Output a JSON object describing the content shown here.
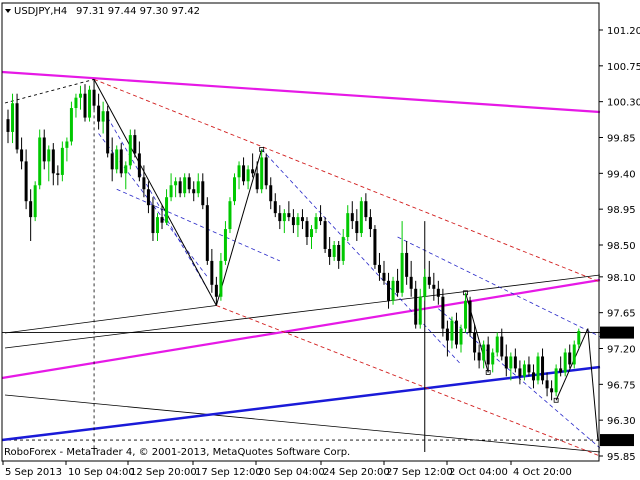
{
  "header": {
    "symbol": "USDJPY,H4",
    "ohlc": "97.31 97.44 97.30 97.42"
  },
  "footer": {
    "copyright": "RoboForex - MetaTrader 4, © 2001-2013, MetaQuotes Software Corp."
  },
  "colors": {
    "bull": "#00c800",
    "bear": "#000000",
    "magenta": "#e619e6",
    "blue": "#1a1ad8",
    "red_dash": "#d21e1e",
    "blue_dash": "#2828c8",
    "thin": "#000000",
    "badge_bg": "#000000",
    "badge_text": "#ffffff"
  },
  "chart_data": {
    "type": "candlestick",
    "title": "USDJPY,H4",
    "ylim": [
      95.7,
      101.5
    ],
    "y_ticks": [
      "101.20",
      "100.75",
      "100.30",
      "99.85",
      "99.40",
      "98.95",
      "98.50",
      "98.10",
      "97.65",
      "97.20",
      "96.75",
      "96.30",
      "95.85"
    ],
    "badges": [
      {
        "label": "97.40",
        "value": 97.4
      },
      {
        "label": "96.05",
        "value": 96.05
      }
    ],
    "x_ticks": [
      "5 Sep 2013",
      "10 Sep 04:00",
      "12 Sep 20:00",
      "17 Sep 12:00",
      "20 Sep 04:00",
      "24 Sep 20:00",
      "27 Sep 12:00",
      "2 Oct 04:00",
      "4 Oct 20:00"
    ],
    "anchors": [
      {
        "bar": 19,
        "high": 100.58
      },
      {
        "bar": 46,
        "low": 97.74
      },
      {
        "bar": 56,
        "high": 99.7
      },
      {
        "bar": 87,
        "high": 98.8
      },
      {
        "bar": 101,
        "high": 97.9
      },
      {
        "bar": 106,
        "low": 96.9
      },
      {
        "bar": 121,
        "low": 96.55
      },
      {
        "bar": 128,
        "high": 97.45
      }
    ],
    "candles": [
      [
        100.08,
        100.2,
        99.78,
        99.92
      ],
      [
        99.92,
        100.4,
        99.78,
        100.28
      ],
      [
        100.28,
        100.4,
        99.65,
        99.7
      ],
      [
        99.7,
        99.85,
        99.45,
        99.55
      ],
      [
        99.55,
        99.7,
        98.95,
        99.05
      ],
      [
        99.05,
        99.2,
        98.55,
        98.85
      ],
      [
        98.85,
        99.3,
        98.8,
        99.25
      ],
      [
        99.25,
        99.95,
        99.2,
        99.85
      ],
      [
        99.85,
        99.95,
        99.45,
        99.55
      ],
      [
        99.55,
        99.75,
        99.3,
        99.7
      ],
      [
        99.7,
        99.78,
        99.25,
        99.4
      ],
      [
        99.4,
        99.5,
        99.25,
        99.38
      ],
      [
        99.38,
        99.8,
        99.3,
        99.72
      ],
      [
        99.72,
        99.85,
        99.55,
        99.8
      ],
      [
        99.8,
        100.3,
        99.75,
        100.22
      ],
      [
        100.22,
        100.4,
        100.1,
        100.35
      ],
      [
        100.35,
        100.5,
        100.2,
        100.4
      ],
      [
        100.4,
        100.52,
        100.05,
        100.1
      ],
      [
        100.1,
        100.5,
        100.05,
        100.45
      ],
      [
        100.45,
        100.58,
        100.2,
        100.25
      ],
      [
        100.25,
        100.4,
        99.95,
        100.05
      ],
      [
        100.05,
        100.3,
        99.9,
        100.18
      ],
      [
        100.18,
        100.25,
        99.6,
        99.65
      ],
      [
        99.65,
        99.85,
        99.3,
        99.45
      ],
      [
        99.45,
        99.75,
        99.4,
        99.7
      ],
      [
        99.7,
        99.78,
        99.35,
        99.4
      ],
      [
        99.4,
        99.55,
        99.2,
        99.5
      ],
      [
        99.5,
        99.95,
        99.45,
        99.88
      ],
      [
        99.88,
        99.95,
        99.6,
        99.65
      ],
      [
        99.65,
        99.8,
        99.3,
        99.35
      ],
      [
        99.35,
        99.5,
        99.1,
        99.2
      ],
      [
        99.2,
        99.3,
        98.9,
        99.0
      ],
      [
        99.0,
        99.1,
        98.55,
        98.65
      ],
      [
        98.65,
        98.9,
        98.55,
        98.85
      ],
      [
        98.85,
        99.0,
        98.7,
        98.78
      ],
      [
        98.78,
        99.2,
        98.75,
        99.1
      ],
      [
        99.1,
        99.4,
        99.05,
        99.25
      ],
      [
        99.25,
        99.35,
        99.1,
        99.3
      ],
      [
        99.3,
        99.35,
        99.1,
        99.15
      ],
      [
        99.15,
        99.4,
        99.1,
        99.35
      ],
      [
        99.35,
        99.4,
        99.15,
        99.2
      ],
      [
        99.2,
        99.3,
        99.05,
        99.15
      ],
      [
        99.15,
        99.4,
        99.1,
        99.3
      ],
      [
        99.3,
        99.4,
        98.95,
        99.0
      ],
      [
        99.0,
        99.1,
        98.25,
        98.3
      ],
      [
        98.3,
        98.45,
        97.9,
        98.0
      ],
      [
        98.0,
        98.1,
        97.74,
        97.85
      ],
      [
        97.85,
        98.4,
        97.8,
        98.3
      ],
      [
        98.3,
        98.8,
        98.25,
        98.7
      ],
      [
        98.7,
        99.1,
        98.65,
        99.05
      ],
      [
        99.05,
        99.4,
        99.0,
        99.35
      ],
      [
        99.35,
        99.55,
        99.2,
        99.5
      ],
      [
        99.5,
        99.6,
        99.25,
        99.3
      ],
      [
        99.3,
        99.5,
        99.2,
        99.45
      ],
      [
        99.45,
        99.65,
        99.35,
        99.4
      ],
      [
        99.4,
        99.55,
        99.15,
        99.2
      ],
      [
        99.2,
        99.7,
        99.15,
        99.6
      ],
      [
        99.6,
        99.65,
        99.2,
        99.25
      ],
      [
        99.25,
        99.35,
        98.95,
        99.05
      ],
      [
        99.05,
        99.15,
        98.85,
        98.9
      ],
      [
        98.9,
        99.0,
        98.7,
        98.8
      ],
      [
        98.8,
        98.95,
        98.65,
        98.9
      ],
      [
        98.9,
        99.05,
        98.8,
        98.85
      ],
      [
        98.85,
        98.95,
        98.65,
        98.75
      ],
      [
        98.75,
        98.9,
        98.6,
        98.85
      ],
      [
        98.85,
        98.95,
        98.7,
        98.8
      ],
      [
        98.8,
        98.85,
        98.5,
        98.6
      ],
      [
        98.6,
        98.75,
        98.45,
        98.7
      ],
      [
        98.7,
        98.9,
        98.65,
        98.85
      ],
      [
        98.85,
        99.0,
        98.75,
        98.8
      ],
      [
        98.8,
        98.85,
        98.4,
        98.45
      ],
      [
        98.45,
        98.6,
        98.25,
        98.35
      ],
      [
        98.35,
        98.55,
        98.3,
        98.5
      ],
      [
        98.5,
        98.55,
        98.2,
        98.3
      ],
      [
        98.3,
        98.7,
        98.25,
        98.6
      ],
      [
        98.6,
        99.0,
        98.55,
        98.9
      ],
      [
        98.9,
        99.05,
        98.7,
        98.8
      ],
      [
        98.8,
        98.95,
        98.55,
        98.65
      ],
      [
        98.65,
        99.1,
        98.6,
        99.05
      ],
      [
        99.05,
        99.15,
        98.8,
        98.85
      ],
      [
        98.85,
        98.95,
        98.6,
        98.7
      ],
      [
        98.7,
        98.75,
        98.2,
        98.25
      ],
      [
        98.25,
        98.4,
        98.05,
        98.15
      ],
      [
        98.15,
        98.3,
        98.0,
        98.05
      ],
      [
        98.05,
        98.15,
        97.7,
        97.8
      ],
      [
        97.8,
        98.1,
        97.75,
        98.05
      ],
      [
        98.05,
        98.2,
        97.85,
        97.9
      ],
      [
        97.9,
        98.8,
        97.85,
        98.4
      ],
      [
        98.4,
        98.55,
        98.0,
        98.1
      ],
      [
        98.1,
        98.3,
        97.85,
        97.95
      ],
      [
        97.95,
        98.05,
        97.45,
        97.5
      ],
      [
        97.5,
        97.95,
        97.45,
        97.85
      ],
      [
        97.85,
        98.2,
        97.8,
        98.1
      ],
      [
        98.1,
        98.3,
        97.95,
        98.0
      ],
      [
        98.0,
        98.15,
        97.8,
        97.95
      ],
      [
        97.95,
        98.05,
        97.75,
        97.85
      ],
      [
        97.85,
        97.95,
        97.35,
        97.45
      ],
      [
        97.45,
        97.55,
        97.1,
        97.3
      ],
      [
        97.3,
        97.6,
        97.2,
        97.55
      ],
      [
        97.55,
        97.65,
        97.2,
        97.25
      ],
      [
        97.25,
        97.5,
        97.15,
        97.45
      ],
      [
        97.45,
        97.9,
        97.4,
        97.8
      ],
      [
        97.8,
        97.85,
        97.35,
        97.4
      ],
      [
        97.4,
        97.5,
        97.05,
        97.15
      ],
      [
        97.15,
        97.25,
        96.95,
        97.05
      ],
      [
        97.05,
        97.3,
        96.95,
        97.25
      ],
      [
        97.25,
        97.35,
        96.9,
        97.0
      ],
      [
        97.0,
        97.2,
        96.9,
        97.15
      ],
      [
        97.15,
        97.4,
        97.1,
        97.35
      ],
      [
        97.35,
        97.45,
        97.05,
        97.1
      ],
      [
        97.1,
        97.25,
        96.85,
        96.95
      ],
      [
        96.95,
        97.15,
        96.8,
        97.1
      ],
      [
        97.1,
        97.2,
        96.9,
        96.95
      ],
      [
        96.95,
        97.05,
        96.75,
        96.85
      ],
      [
        96.85,
        97.05,
        96.8,
        97.0
      ],
      [
        97.0,
        97.1,
        96.85,
        96.9
      ],
      [
        96.9,
        97.0,
        96.7,
        96.8
      ],
      [
        96.8,
        97.15,
        96.75,
        97.1
      ],
      [
        97.1,
        97.2,
        96.75,
        96.8
      ],
      [
        96.8,
        96.9,
        96.6,
        96.7
      ],
      [
        96.7,
        96.8,
        96.55,
        96.65
      ],
      [
        96.65,
        97.0,
        96.6,
        96.95
      ],
      [
        96.95,
        97.1,
        96.85,
        96.9
      ],
      [
        96.9,
        97.2,
        96.85,
        97.15
      ],
      [
        97.15,
        97.25,
        96.95,
        97.0
      ],
      [
        97.0,
        97.3,
        96.95,
        97.25
      ],
      [
        97.25,
        97.45,
        97.2,
        97.42
      ]
    ]
  }
}
